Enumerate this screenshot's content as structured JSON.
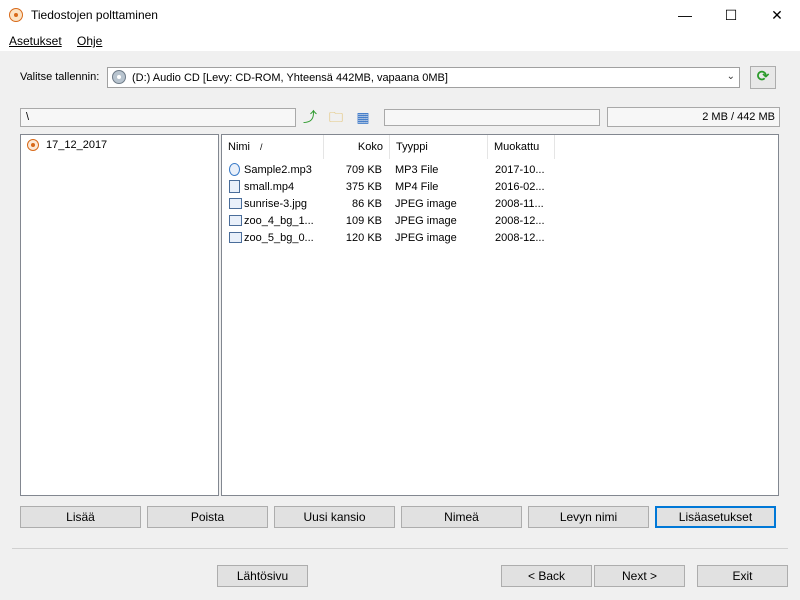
{
  "window": {
    "title": "Tiedostojen polttaminen",
    "min": "—",
    "max": "☐",
    "close": "✕"
  },
  "menu": [
    {
      "label": "Asetukset"
    },
    {
      "label": "Ohje"
    }
  ],
  "recorder": {
    "label": "Valitse tallennin:",
    "selected": "(D:) Audio CD [Levy: CD-ROM, Yhteensä 442MB, vapaana 0MB]"
  },
  "path": "\\",
  "capacity": {
    "text": "2 MB / 442 MB",
    "used_fraction": 0.0
  },
  "tree": [
    {
      "label": "17_12_2017"
    }
  ],
  "columns": {
    "name": "Nimi",
    "sort": "/",
    "size": "Koko",
    "type": "Tyyppi",
    "modified": "Muokattu"
  },
  "files": [
    {
      "name": "Sample2.mp3",
      "size": "709 KB",
      "type": "MP3 File",
      "modified": "2017-10...",
      "icon": "audio-file-icon"
    },
    {
      "name": "small.mp4",
      "size": "375 KB",
      "type": "MP4 File",
      "modified": "2016-02...",
      "icon": "video-file-icon"
    },
    {
      "name": "sunrise-3.jpg",
      "size": "86 KB",
      "type": "JPEG image",
      "modified": "2008-11...",
      "icon": "image-file-icon"
    },
    {
      "name": "zoo_4_bg_1...",
      "size": "109 KB",
      "type": "JPEG image",
      "modified": "2008-12...",
      "icon": "image-file-icon"
    },
    {
      "name": "zoo_5_bg_0...",
      "size": "120 KB",
      "type": "JPEG image",
      "modified": "2008-12...",
      "icon": "image-file-icon"
    }
  ],
  "buttons": {
    "add": "Lisää",
    "remove": "Poista",
    "new_folder": "Uusi kansio",
    "rename": "Nimeä",
    "disc_name": "Levyn nimi",
    "advanced": "Lisäasetukset"
  },
  "nav": {
    "home": "Lähtösivu",
    "back": "< Back",
    "next": "Next >",
    "exit": "Exit"
  }
}
